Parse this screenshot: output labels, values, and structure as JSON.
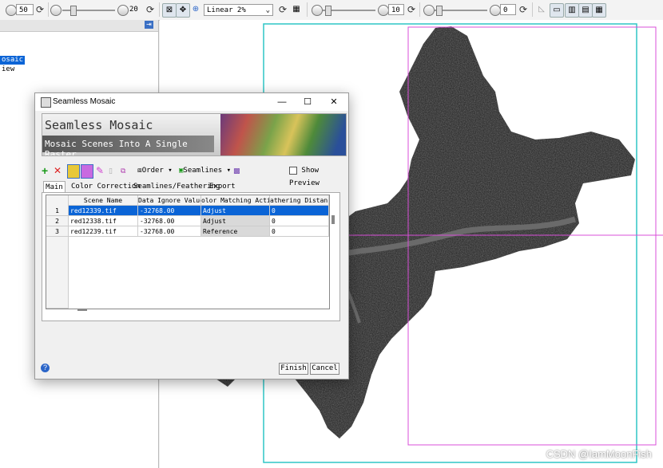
{
  "toolbar": {
    "brightness_value": "50",
    "contrast_value": "20",
    "stretch_option": "Linear 2%",
    "sharpen_value": "10",
    "transparency_value": "0"
  },
  "layers": {
    "item1": "osaic",
    "item2": "iew"
  },
  "dialog": {
    "title": "Seamless Mosaic",
    "banner_title": "Seamless Mosaic",
    "banner_subtitle": "Mosaic Scenes Into A Single Raster",
    "tools": {
      "order_label": "Order",
      "seamlines_label": "Seamlines",
      "show_preview_label": "Show Preview"
    },
    "tabs": [
      "Main",
      "Color Correction",
      "Seamlines/Feathering",
      "Export"
    ],
    "table": {
      "columns": [
        "Scene Name",
        "Data Ignore Value",
        "olor Matching Actio",
        "athering Distanc"
      ],
      "rows": [
        {
          "num": "1",
          "scene": "red12339.tif",
          "ignore": "-32768.00",
          "action": "Adjust",
          "distance": "0"
        },
        {
          "num": "2",
          "scene": "red12338.tif",
          "ignore": "-32768.00",
          "action": "Adjust",
          "distance": "0"
        },
        {
          "num": "3",
          "scene": "red12239.tif",
          "ignore": "-32768.00",
          "action": "Reference",
          "distance": "0"
        }
      ]
    },
    "buttons": {
      "finish": "Finish",
      "cancel": "Cancel"
    }
  },
  "watermark": "CSDN @IamMoonFish",
  "colors": {
    "selection": "#0a64d6",
    "footprint_cyan": "#2fc6c6",
    "footprint_magenta": "#d84fd8"
  }
}
